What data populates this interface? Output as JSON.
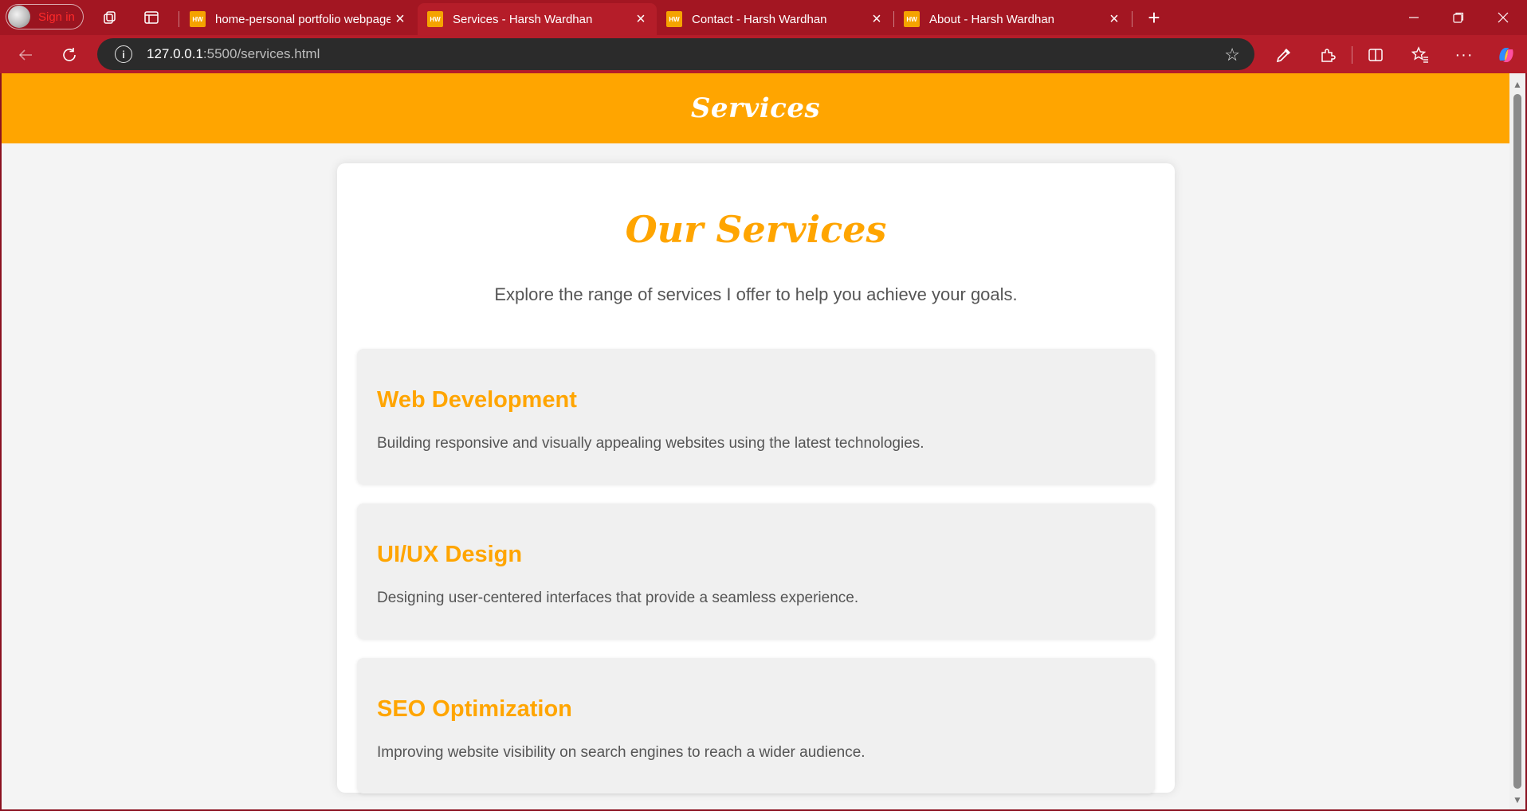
{
  "browser": {
    "profile": {
      "label": "Sign in"
    },
    "tabs": [
      {
        "favicon": "HW",
        "title": "home-personal portfolio webpage",
        "active": false
      },
      {
        "favicon": "HW",
        "title": "Services - Harsh Wardhan",
        "active": true
      },
      {
        "favicon": "HW",
        "title": "Contact - Harsh Wardhan",
        "active": false
      },
      {
        "favicon": "HW",
        "title": "About - Harsh Wardhan",
        "active": false
      }
    ],
    "address": {
      "host": "127.0.0.1",
      "rest": ":5500/services.html"
    },
    "icons": {
      "workspaces": "workspaces-icon",
      "tab_actions": "tab-actions-icon",
      "new_tab": "plus-icon",
      "back": "back-arrow-icon",
      "refresh": "refresh-icon",
      "site_info": "info-icon",
      "favorite": "star-icon",
      "eyedropper": "eyedropper-icon",
      "extensions": "puzzle-icon",
      "split_screen": "split-screen-icon",
      "favorites": "favorites-icon",
      "more": "more-icon",
      "copilot": "copilot-icon"
    }
  },
  "page": {
    "header_title": "Services",
    "section_title": "Our Services",
    "intro": "Explore the range of services I offer to help you achieve your goals.",
    "services": [
      {
        "title": "Web Development",
        "description": "Building responsive and visually appealing websites using the latest technologies."
      },
      {
        "title": "UI/UX Design",
        "description": "Designing user-centered interfaces that provide a seamless experience."
      },
      {
        "title": "SEO Optimization",
        "description": "Improving website visibility on search engines to reach a wider audience."
      }
    ]
  },
  "colors": {
    "accent": "#ffa500",
    "tabbar": "#a31622",
    "toolbar": "#b51d29",
    "card_bg": "#f0f0f0",
    "body_text": "#555555"
  }
}
